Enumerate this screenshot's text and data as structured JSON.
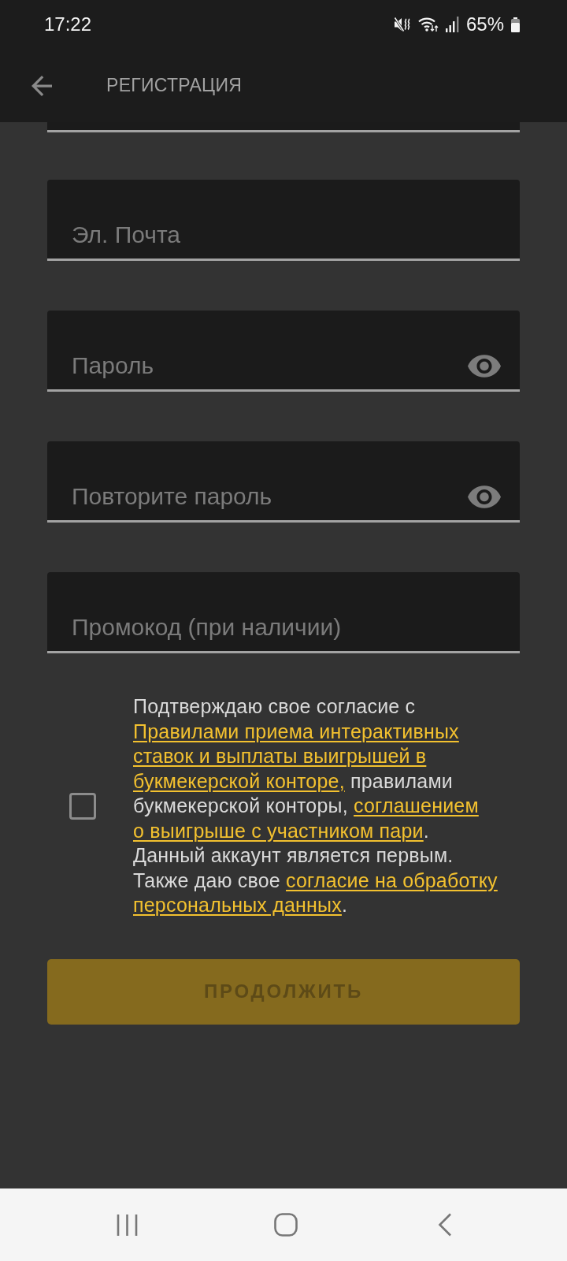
{
  "status_bar": {
    "time": "17:22",
    "battery": "65%"
  },
  "header": {
    "title": "РЕГИСТРАЦИЯ"
  },
  "fields": [
    {
      "kind": "text",
      "placeholder": "Эл. Почта"
    },
    {
      "kind": "password",
      "placeholder": "Пароль"
    },
    {
      "kind": "password",
      "placeholder": "Повторите пароль"
    },
    {
      "kind": "text",
      "placeholder": "Промокод (при наличии)"
    }
  ],
  "consent": {
    "checked": false,
    "lines": [
      [
        {
          "kind": "text",
          "text": "Подтверждаю свое согласие с"
        }
      ],
      [
        {
          "kind": "link",
          "text": "Правилами приема интерактивных"
        }
      ],
      [
        {
          "kind": "link",
          "text": "ставок и выплаты выигрышей в"
        }
      ],
      [
        {
          "kind": "link",
          "text": "букмекерской конторе,"
        },
        {
          "kind": "text",
          "text": " правилами"
        }
      ],
      [
        {
          "kind": "text",
          "text": "букмекерской конторы, "
        },
        {
          "kind": "link",
          "text": "соглашением"
        }
      ],
      [
        {
          "kind": "link",
          "text": "о выигрыше с участником пари"
        },
        {
          "kind": "text",
          "text": "."
        }
      ],
      [
        {
          "kind": "text",
          "text": "Данный аккаунт является первым."
        }
      ],
      [
        {
          "kind": "text",
          "text": "Также даю свое "
        },
        {
          "kind": "link",
          "text": "согласие на обработку"
        }
      ],
      [
        {
          "kind": "link",
          "text": "персональных данных"
        },
        {
          "kind": "text",
          "text": "."
        }
      ]
    ]
  },
  "continue_button": {
    "label": "ПРОДОЛЖИТЬ",
    "disabled": true
  }
}
